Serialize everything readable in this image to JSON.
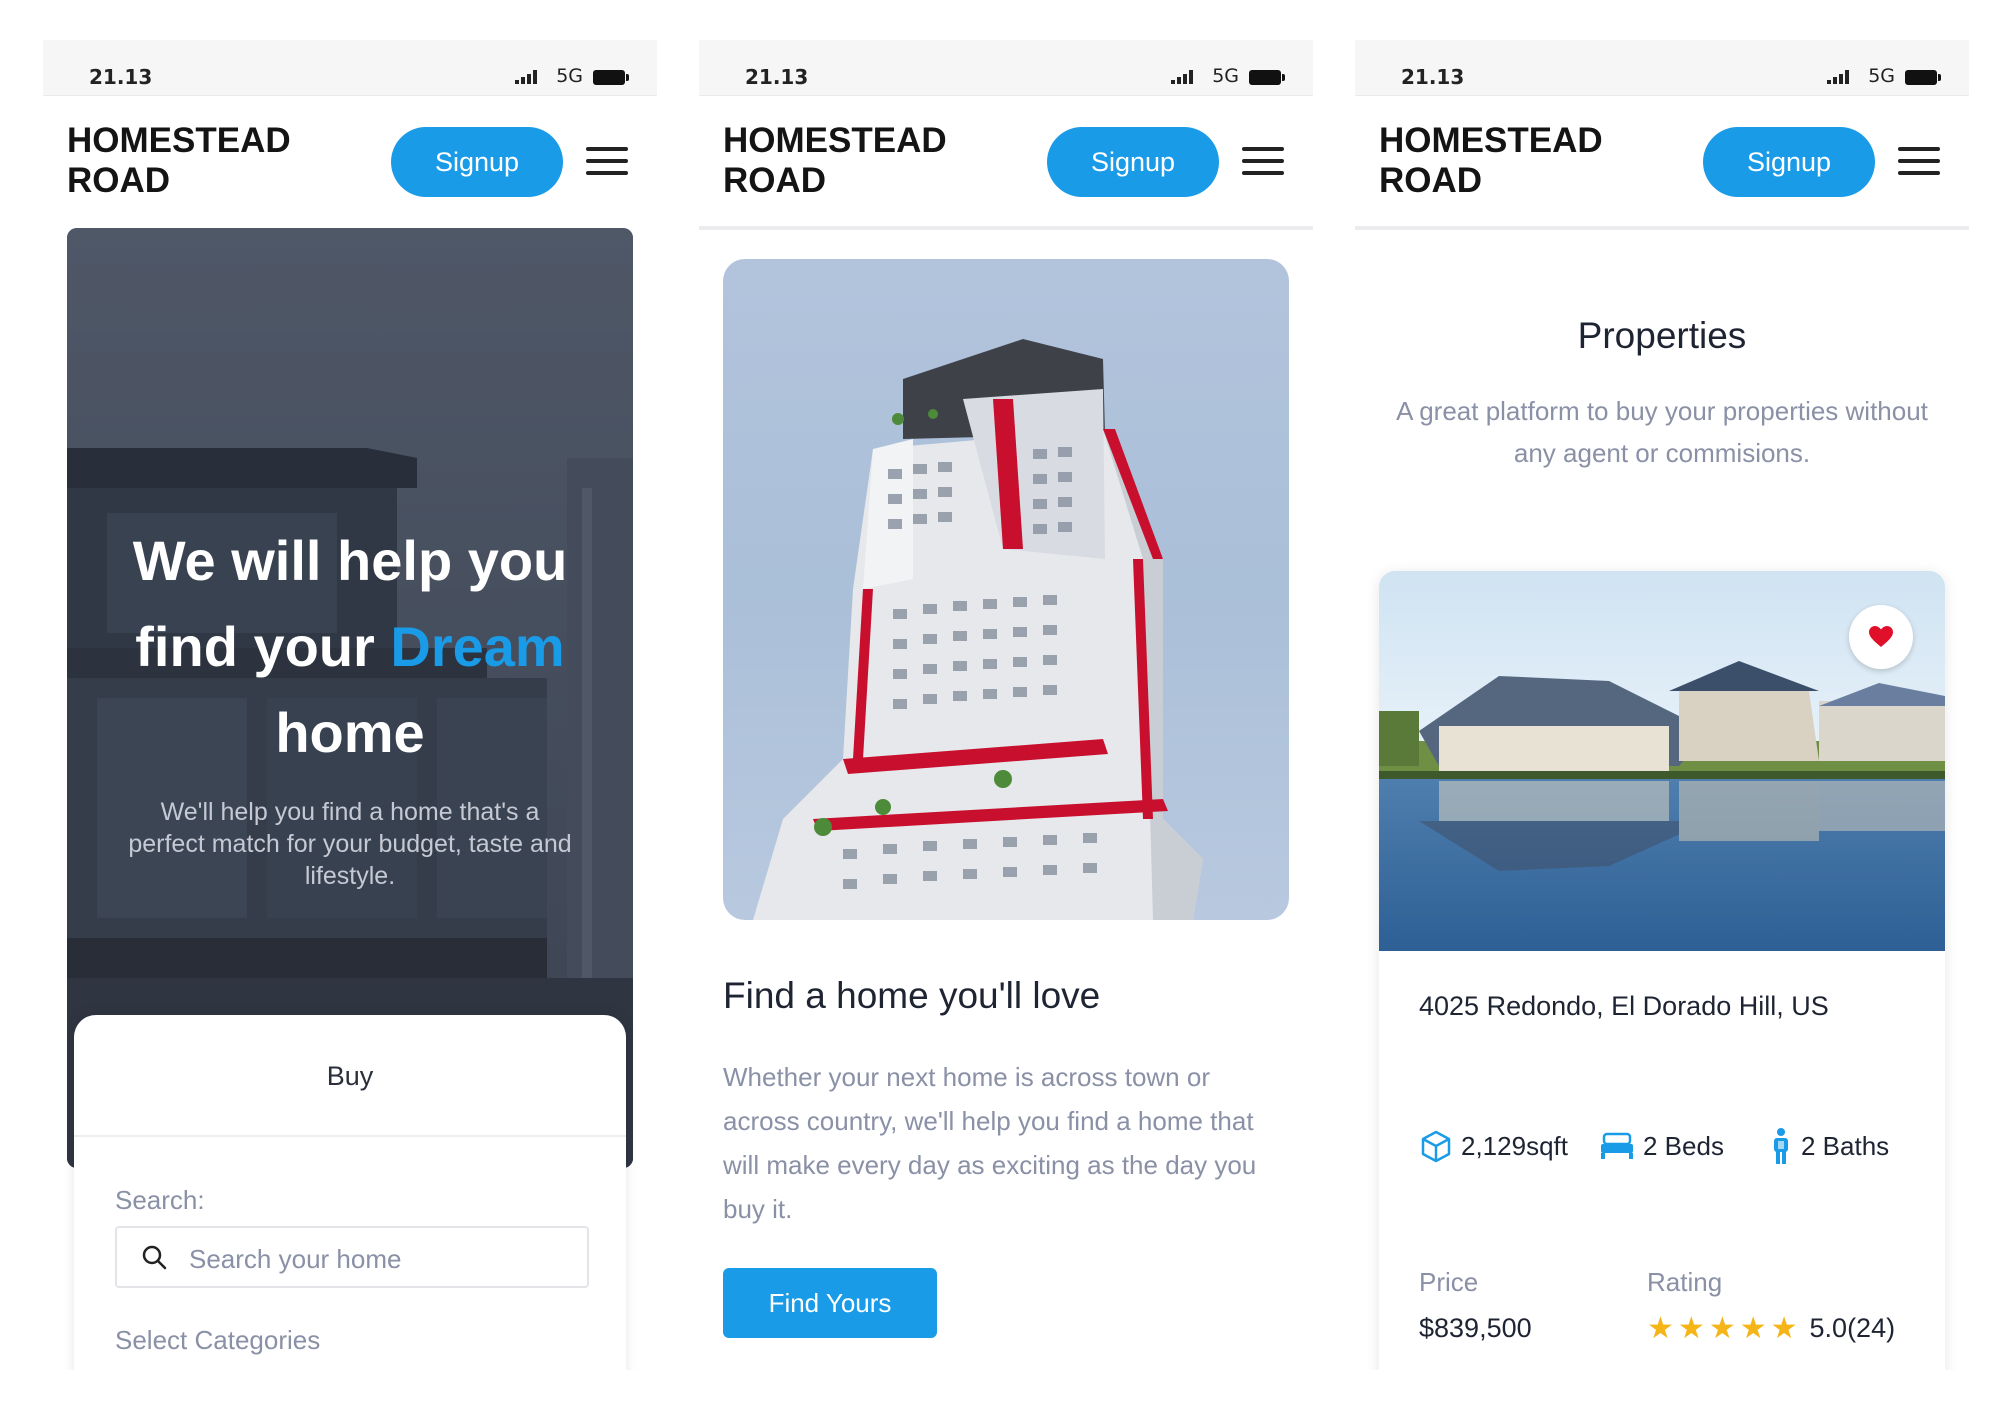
{
  "status": {
    "time": "21.13",
    "network": "5G"
  },
  "brand": {
    "name": "HOMESTEAD ROAD"
  },
  "nav": {
    "signup_label": "Signup"
  },
  "colors": {
    "accent": "#1a9be7",
    "muted": "#8a90a6",
    "star": "#f5b418",
    "heart": "#e0102b"
  },
  "screen1": {
    "hero": {
      "title_before": "We will help you find your ",
      "title_accent": "Dream",
      "title_after": " home",
      "subtitle": "We'll help you find a home that's a perfect match for your budget, taste and lifestyle."
    },
    "search_card": {
      "tab_label": "Buy",
      "search_label": "Search:",
      "search_placeholder": "Search your home",
      "categories_label": "Select Categories"
    }
  },
  "screen2": {
    "title": "Find a home you'll love",
    "description": "Whether your next home is across town or across country, we'll help you find a home that will make every day as exciting as the day you buy it.",
    "cta_label": "Find Yours"
  },
  "screen3": {
    "title": "Properties",
    "subtitle": "A great platform to buy your properties without any agent or commisions.",
    "property": {
      "address": "4025 Redondo, El Dorado Hill, US",
      "area": "2,129sqft",
      "beds": "2 Beds",
      "baths": "2 Baths",
      "price_label": "Price",
      "price": "$839,500",
      "rating_label": "Rating",
      "rating_stars": 5,
      "rating_value": "5.0(24)"
    }
  },
  "icons": [
    "signal-icon",
    "battery-icon",
    "menu-icon",
    "search-icon",
    "heart-icon",
    "cube-icon",
    "bed-icon",
    "person-icon",
    "star-icon"
  ]
}
